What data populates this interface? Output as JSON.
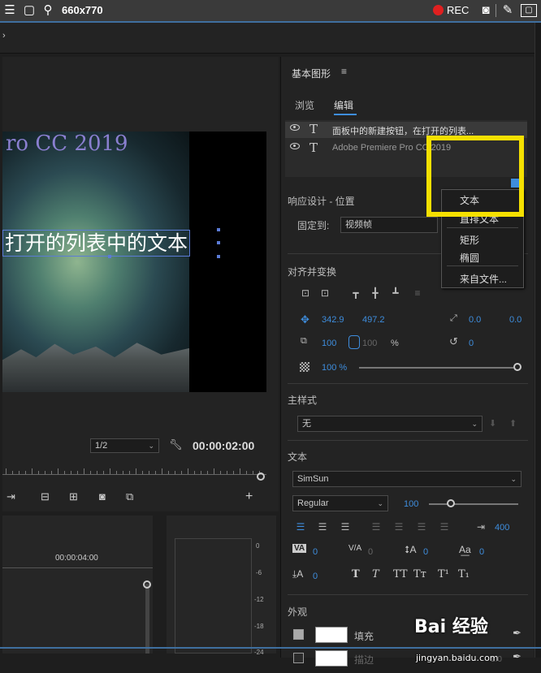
{
  "topbar": {
    "title": "660x770",
    "rec": "REC"
  },
  "video": {
    "title": "ro CC 2019",
    "text": "打开的列表中的文本"
  },
  "monitor": {
    "zoom": "1/2",
    "timecode": "00:00:02:00"
  },
  "timeline": {
    "timecode": "00:00:04:00"
  },
  "meter": {
    "ticks": [
      "0",
      "-6",
      "-12",
      "-18",
      "-24"
    ]
  },
  "panel": {
    "title": "基本图形",
    "tabs": [
      "浏览",
      "编辑"
    ],
    "layers": [
      "面板中的新建按钮，在打开的列表...",
      "Adobe Premiere Pro CC 2019"
    ],
    "menu": [
      "文本",
      "直排文本",
      "矩形",
      "椭圆",
      "来自文件..."
    ],
    "responsive": {
      "label": "响应设计 - 位置",
      "pin_label": "固定到:",
      "pin_value": "视频帧"
    },
    "align": {
      "label": "对齐并变换",
      "pos_x": "342.9",
      "pos_y": "497.2",
      "anchor_x": "0.0",
      "anchor_y": "0.0",
      "scale": "100",
      "scale2": "100",
      "percent": "%",
      "rotation": "0",
      "opacity": "100 %"
    },
    "master": {
      "label": "主样式",
      "value": "无"
    },
    "text": {
      "label": "文本",
      "font": "SimSun",
      "style": "Regular",
      "size": "100",
      "tab_width": "400",
      "kerning": "0",
      "tracking": "0",
      "baseline": "0",
      "tsume": "0",
      "leading": "0",
      "styles": [
        "T",
        "T",
        "TT",
        "Tт",
        "T¹",
        "T₁"
      ]
    },
    "appearance": {
      "label": "外观",
      "fill": "填充",
      "stroke": "描边",
      "stroke_width": "1.0"
    }
  },
  "watermark": {
    "brand": "Bai 经验",
    "url": "jingyan.baidu.com"
  },
  "colors": {
    "accent": "#3e8ddd",
    "highlight": "#f5e000",
    "rec": "#e02020"
  }
}
